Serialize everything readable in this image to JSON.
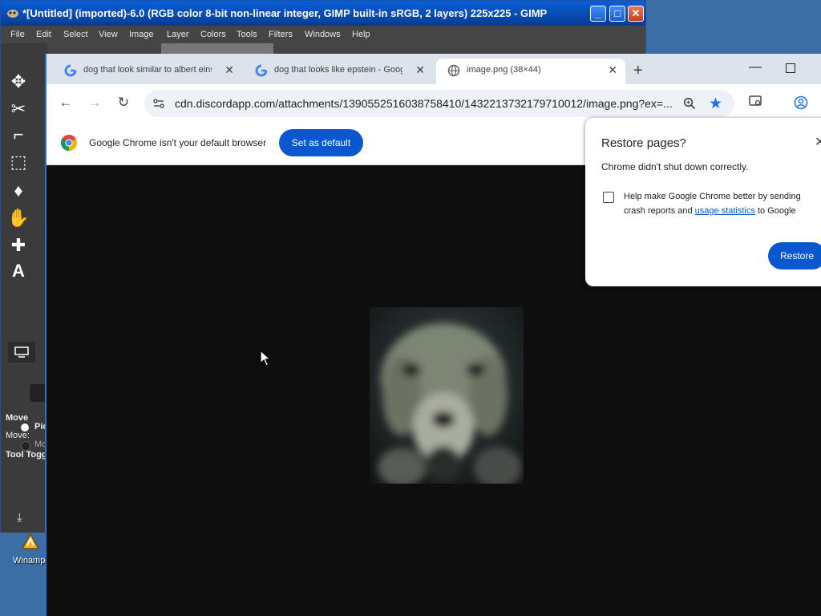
{
  "desktop": {
    "winamp_label": "Winamp"
  },
  "gimp": {
    "title": "*[Untitled] (imported)-6.0 (RGB color 8-bit non-linear integer, GIMP built-in sRGB, 2 layers) 225x225 - GIMP",
    "menu": [
      "File",
      "Edit",
      "Select",
      "View",
      "Image",
      "Layer",
      "Colors",
      "Tools",
      "Filters",
      "Windows",
      "Help"
    ],
    "tool_options": {
      "title": "Move",
      "move_label": "Move:",
      "toggle_label": "Tool Togg",
      "radio1": "Pic",
      "radio2": "Mo"
    }
  },
  "chrome": {
    "tabs": [
      {
        "title": "dog that look similar to albert einstein - Google Search",
        "active": false
      },
      {
        "title": "dog that looks like epstein - Google Search",
        "active": false
      },
      {
        "title": "image.png (38×44)",
        "active": true
      }
    ],
    "url": "cdn.discordapp.com/attachments/1390552516038758410/1432213732179710012/image.png?ex=...",
    "infobar": {
      "text": "Google Chrome isn't your default browser",
      "button": "Set as default"
    },
    "restore_popup": {
      "title": "Restore pages?",
      "message": "Chrome didn't shut down correctly.",
      "help_line1": "Help make Google Chrome better by sending",
      "help_line2_pre": "crash reports and",
      "help_link": "usage statistics",
      "help_line2_post": "to Google",
      "button": "Restore"
    }
  },
  "colors": {
    "accent": "#0b57d0",
    "gimp_title": "#0a5fd7",
    "viewer_bg": "#0e0e0e"
  }
}
